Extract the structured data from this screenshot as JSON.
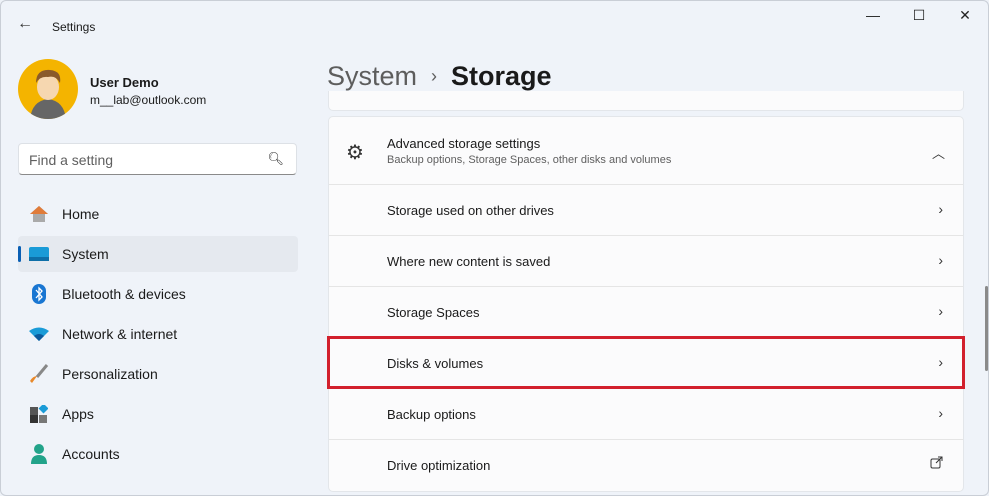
{
  "app": {
    "title": "Settings"
  },
  "window_controls": {
    "minimize": "—",
    "maximize": "☐",
    "close": "✕"
  },
  "user": {
    "name": "User Demo",
    "email": "m__lab@outlook.com"
  },
  "search": {
    "placeholder": "Find a setting"
  },
  "sidebar": {
    "items": [
      {
        "label": "Home",
        "icon": "home-icon"
      },
      {
        "label": "System",
        "icon": "system-icon",
        "selected": true
      },
      {
        "label": "Bluetooth & devices",
        "icon": "bluetooth-icon"
      },
      {
        "label": "Network & internet",
        "icon": "wifi-icon"
      },
      {
        "label": "Personalization",
        "icon": "brush-icon"
      },
      {
        "label": "Apps",
        "icon": "apps-icon"
      },
      {
        "label": "Accounts",
        "icon": "accounts-icon"
      }
    ]
  },
  "breadcrumb": {
    "parent": "System",
    "separator": "›",
    "current": "Storage"
  },
  "section": {
    "title": "Advanced storage settings",
    "subtitle": "Backup options, Storage Spaces, other disks and volumes",
    "items": [
      {
        "label": "Storage used on other drives",
        "icon": "chevron-right"
      },
      {
        "label": "Where new content is saved",
        "icon": "chevron-right"
      },
      {
        "label": "Storage Spaces",
        "icon": "chevron-right"
      },
      {
        "label": "Disks & volumes",
        "icon": "chevron-right",
        "highlighted": true
      },
      {
        "label": "Backup options",
        "icon": "chevron-right"
      },
      {
        "label": "Drive optimization",
        "icon": "external-link"
      }
    ]
  },
  "colors": {
    "accent": "#0a5fb4",
    "highlight": "#d2202d"
  }
}
